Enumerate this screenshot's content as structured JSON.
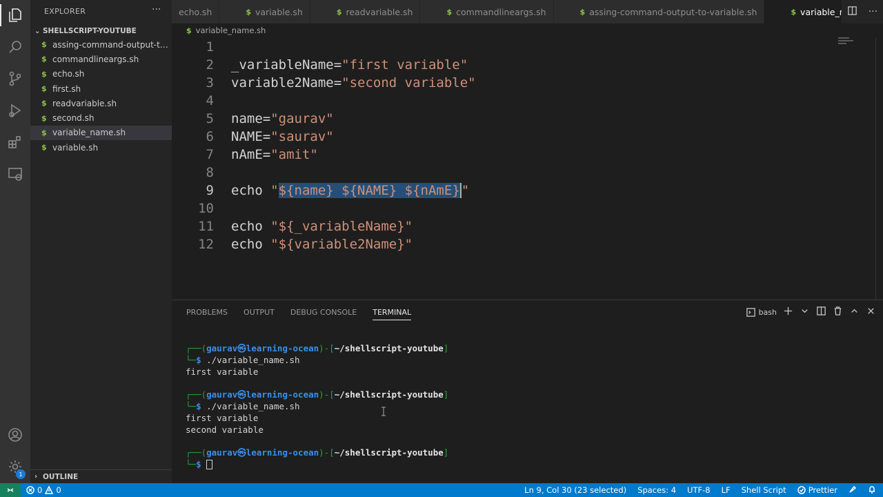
{
  "sidebar": {
    "title": "EXPLORER",
    "more": "···",
    "folder": "SHELLSCRIPT-YOUTUBE",
    "files": [
      "assing-command-output-to-variable.sh",
      "commandlineargs.sh",
      "echo.sh",
      "first.sh",
      "readvariable.sh",
      "second.sh",
      "variable_name.sh",
      "variable.sh"
    ],
    "outline": "OUTLINE"
  },
  "tabs": [
    {
      "label": "echo.sh"
    },
    {
      "label": "variable.sh"
    },
    {
      "label": "readvariable.sh"
    },
    {
      "label": "commandlineargs.sh"
    },
    {
      "label": "assing-command-output-to-variable.sh"
    },
    {
      "label": "variable_name.sh"
    }
  ],
  "breadcrumb": "variable_name.sh",
  "editor": {
    "line_numbers": [
      "1",
      "2",
      "3",
      "4",
      "5",
      "6",
      "7",
      "8",
      "9",
      "10",
      "11",
      "12"
    ],
    "l2_var": "_variableName=",
    "l2_str": "\"first variable\"",
    "l3_var": "variable2Name=",
    "l3_str": "\"second variable\"",
    "l5_var": "name=",
    "l5_str": "\"gaurav\"",
    "l6_var": "NAME=",
    "l6_str": "\"saurav\"",
    "l7_var": "nAmE=",
    "l7_str": "\"amit\"",
    "l9_cmd": "echo ",
    "l9_q1": "\"",
    "l9_sel": "${name} ${NAME} ${nAmE}",
    "l9_q2": "\"",
    "l11_cmd": "echo ",
    "l11_str": "\"${_variableName}\"",
    "l12_cmd": "echo ",
    "l12_str": "\"${variable2Name}\""
  },
  "panel": {
    "tabs": [
      "PROBLEMS",
      "OUTPUT",
      "DEBUG CONSOLE",
      "TERMINAL"
    ],
    "shell": "bash"
  },
  "terminal": {
    "box_top": "┌──(",
    "user": "gaurav",
    "at": "㉿",
    "host": "learning-ocean",
    "mid": ")-[",
    "path": "~/shellscript-youtube",
    "end": "]",
    "box_bot": "└─",
    "dollar": "$",
    "cmd1": " ./variable_name.sh",
    "out1": "first variable",
    "cmd2": " ./variable_name.sh",
    "out2a": "first variable",
    "out2b": "second variable"
  },
  "status": {
    "errors": "0",
    "warnings": "0",
    "position": "Ln 9, Col 30 (23 selected)",
    "spaces": "Spaces: 4",
    "encoding": "UTF-8",
    "eol": "LF",
    "language": "Shell Script",
    "prettier": "Prettier",
    "accounts_badge": "1"
  },
  "colors": {
    "accent": "#007acc",
    "string": "#ce9178",
    "selection": "#264f78",
    "terminal_green": "#22a63b",
    "terminal_blue": "#3b8eea"
  }
}
